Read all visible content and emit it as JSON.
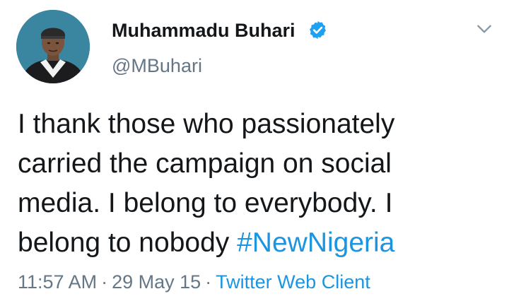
{
  "author": {
    "display_name": "Muhammadu Buhari",
    "handle": "@MBuhari",
    "verified": true
  },
  "tweet": {
    "text_lines": [
      "I thank those who passionately",
      "carried the campaign on social",
      "media. I belong to everybody. I",
      "belong to nobody "
    ],
    "hashtag": "#NewNigeria",
    "time": "11:57 AM",
    "separator": "·",
    "date": "29 May 15",
    "source": "Twitter Web Client"
  },
  "icons": {
    "verified": "verified-badge-icon",
    "menu": "chevron-down-icon"
  },
  "colors": {
    "text": "#14171a",
    "muted": "#657786",
    "link": "#1b95e0",
    "verified": "#1da1f2"
  }
}
